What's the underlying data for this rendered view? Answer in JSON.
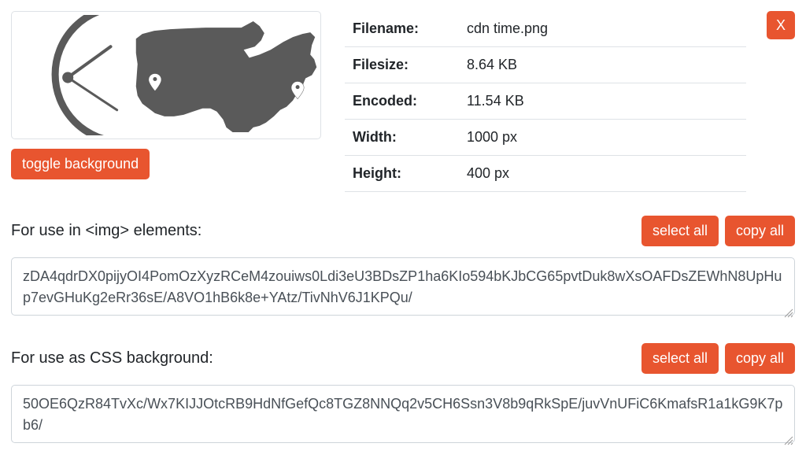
{
  "close_label": "X",
  "info": {
    "filename_label": "Filename:",
    "filename_value": "cdn time.png",
    "filesize_label": "Filesize:",
    "filesize_value": "8.64 KB",
    "encoded_label": "Encoded:",
    "encoded_value": "11.54 KB",
    "width_label": "Width:",
    "width_value": "1000 px",
    "height_label": "Height:",
    "height_value": "400 px"
  },
  "toggle_bg_label": "toggle background",
  "sections": {
    "img": {
      "title": "For use in <img> elements:",
      "select_all": "select all",
      "copy_all": "copy all",
      "content": "zDA4qdrDX0pijyOI4PomOzXyzRCeM4zouiws0Ldi3eU3BDsZP1ha6KIo594bKJbCG65pvtDuk8wXsOAFDsZEWhN8UpHup7evGHuKg2eRr36sE/A8VO1hB6k8e+YAtz/TivNhV6J1KPQu/"
    },
    "css": {
      "title": "For use as CSS background:",
      "select_all": "select all",
      "copy_all": "copy all",
      "content": "50OE6QzR84TvXc/Wx7KIJJOtcRB9HdNfGefQc8TGZ8NNQq2v5CH6Ssn3V8b9qRkSpE/juvVnUFiC6KmafsR1a1kG9K7pb6/"
    }
  },
  "colors": {
    "accent": "#e8552f",
    "border": "#dee2e6",
    "text": "#212529"
  }
}
